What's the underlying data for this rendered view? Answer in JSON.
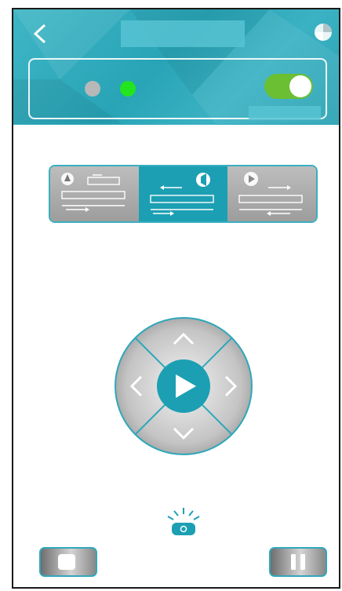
{
  "header": {
    "back_icon": "chevron-left-icon",
    "timer_icon": "clock-icon",
    "title_text": ""
  },
  "status": {
    "indicator_off_color": "#b8b8b8",
    "indicator_on_color": "#22e51e",
    "power_toggle_on": true,
    "label_text": ""
  },
  "modes": {
    "items": [
      {
        "id": "left",
        "icon": "person-upload-icon",
        "selected": false
      },
      {
        "id": "middle",
        "icon": "speaker-sync-icon",
        "selected": true
      },
      {
        "id": "right",
        "icon": "play-circle-icon",
        "selected": false
      }
    ]
  },
  "controls": {
    "dpad_icons": [
      "chevron-up-icon",
      "chevron-down-icon",
      "chevron-left-icon",
      "chevron-right-icon",
      "play-icon"
    ],
    "accent": "#1c9fb3",
    "light_icon": "signal-light-icon",
    "stop_icon": "stop-icon",
    "pause_icon": "pause-icon"
  }
}
